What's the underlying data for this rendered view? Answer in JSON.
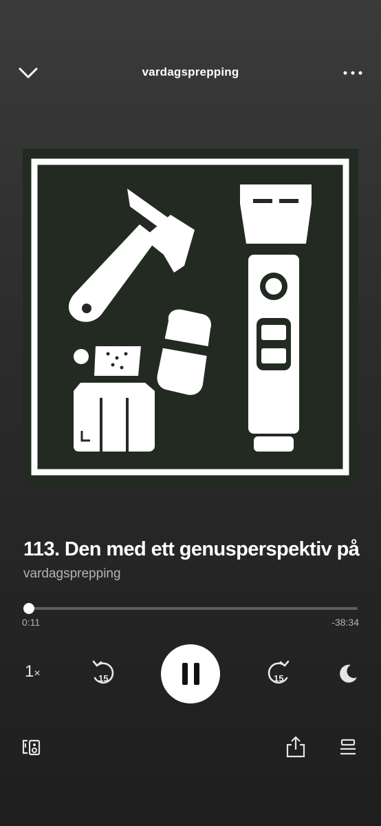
{
  "header": {
    "title": "vardagsprepping"
  },
  "episode": {
    "title": "113. Den med ett genusperspektiv på",
    "show": "vardagsprepping"
  },
  "playback": {
    "elapsed": "0:11",
    "remaining": "-38:34",
    "progress_fraction": 0.005,
    "speed_value": "1",
    "speed_suffix": "×",
    "skip_back_seconds": "15",
    "skip_forward_seconds": "15",
    "is_playing": true
  },
  "icons": {
    "collapse": "chevron-down-icon",
    "more": "more-horizontal-icon",
    "rewind": "skip-back-15-icon",
    "pause": "pause-icon",
    "forward": "skip-forward-15-icon",
    "sleep": "moon-icon",
    "devices": "connect-device-icon",
    "share": "share-icon",
    "queue": "queue-icon"
  },
  "colors": {
    "background_top": "#3b3b3b",
    "background_bottom": "#1e1e1e",
    "artwork_bg": "#222a22",
    "text_secondary": "#b3b3b3",
    "progress_track": "#5e5e5e"
  }
}
